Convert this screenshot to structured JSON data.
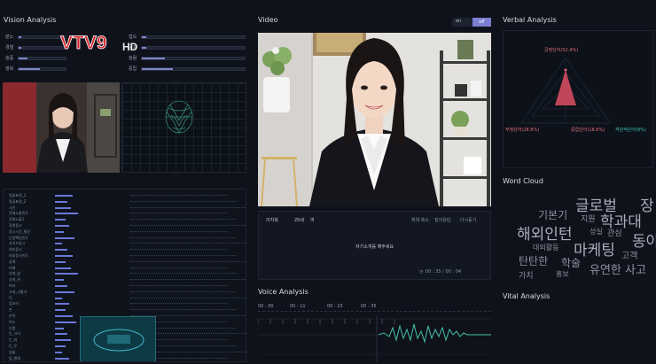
{
  "vision": {
    "title": "Vision Analysis",
    "emotions_left": [
      {
        "label": "분노",
        "value": 0.05
      },
      {
        "label": "경멸",
        "value": 0.05
      },
      {
        "label": "슬픔",
        "value": 0.18
      },
      {
        "label": "행복",
        "value": 0.45
      }
    ],
    "emotions_right": [
      {
        "label": "혐오",
        "value": 0.04
      },
      {
        "label": "공포",
        "value": 0.04
      },
      {
        "label": "놀람",
        "value": 0.22
      },
      {
        "label": "중립",
        "value": 0.3
      }
    ],
    "features": [
      "얼굴표정_1",
      "얼굴표정_2",
      "시선",
      "전체노출빈도",
      "전체노출1",
      "정면응시",
      "응시시간_평균",
      "눈깜빡임빈도",
      "사이드응시",
      "외부응시",
      "외부응시빈도",
      "상체",
      "어깨",
      "상체_앞",
      "상체_뒤",
      "머리",
      "고개_기울기",
      "턱",
      "입꼬리",
      "손",
      "손목",
      "미소",
      "눈썹",
      "눈_크기",
      "눈_좌",
      "눈_우",
      "입술",
      "입_벌림"
    ]
  },
  "logo": {
    "brand": "VTV9",
    "hd": "HD"
  },
  "video": {
    "title": "Video",
    "toggle_on": "on",
    "toggle_off": "off",
    "candidate_name": "이지복",
    "candidate_age": "25세",
    "candidate_gender": "여",
    "action_1": "확대·축소",
    "action_2": "질의응답",
    "action_3": "다시듣기",
    "question": "자기소개를 해주세요",
    "timer": "00 : 35 / 00 : 04"
  },
  "voice": {
    "title": "Voice Analysis",
    "ticks": [
      "00 : 00",
      "00 : 11",
      "00 : 23",
      "00 : 35"
    ]
  },
  "verbal": {
    "title": "Verbal Analysis",
    "labels": {
      "top": "긍정단어(52.4%)",
      "left": "부정단어(28.8%)",
      "mid": "중립단어(18.8%)",
      "right": "객관적단어(8%)"
    }
  },
  "wordcloud": {
    "title": "Word Cloud",
    "words": [
      {
        "text": "글로벌",
        "size": 17
      },
      {
        "text": "장",
        "size": 17
      },
      {
        "text": "기본기",
        "size": 12
      },
      {
        "text": "지원",
        "size": 9
      },
      {
        "text": "학과대",
        "size": 17
      },
      {
        "text": "해외인턴",
        "size": 17
      },
      {
        "text": "성실",
        "size": 8
      },
      {
        "text": "관심",
        "size": 9
      },
      {
        "text": "동아",
        "size": 17
      },
      {
        "text": "대외활동",
        "size": 8
      },
      {
        "text": "마케팅",
        "size": 17
      },
      {
        "text": "고객",
        "size": 10
      },
      {
        "text": "탄탄한",
        "size": 12
      },
      {
        "text": "학술",
        "size": 12
      },
      {
        "text": "유연한",
        "size": 13
      },
      {
        "text": "사고",
        "size": 13
      },
      {
        "text": "가치",
        "size": 9
      },
      {
        "text": "홍보",
        "size": 8
      }
    ]
  },
  "vital": {
    "title": "Vital Analysis"
  }
}
